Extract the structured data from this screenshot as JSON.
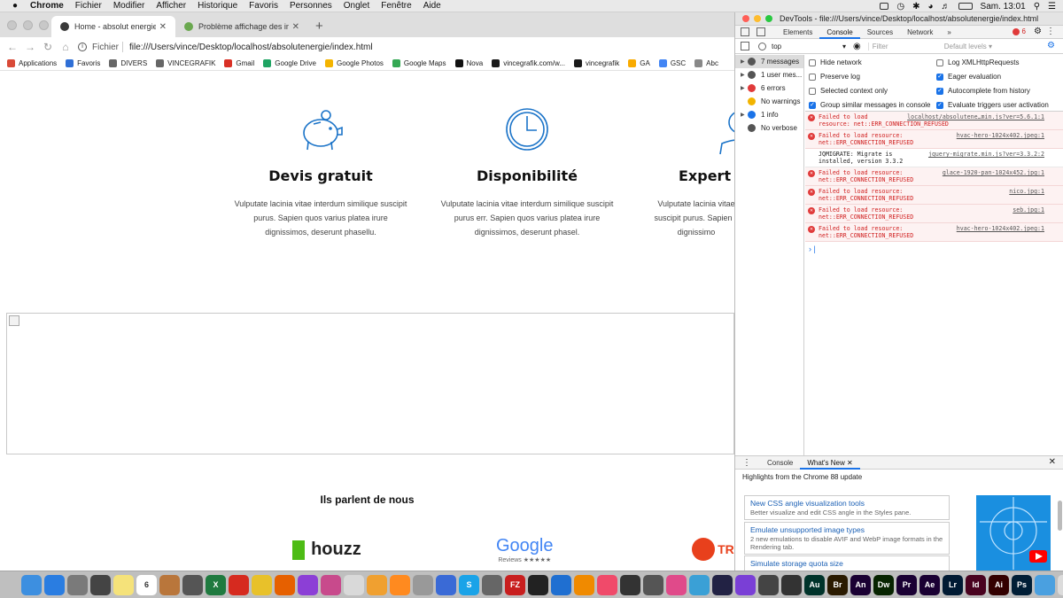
{
  "menubar": {
    "items": [
      "Chrome",
      "Fichier",
      "Modifier",
      "Afficher",
      "Historique",
      "Favoris",
      "Personnes",
      "Onglet",
      "Fenêtre",
      "Aide"
    ],
    "clock": "Sam. 13:01"
  },
  "browser": {
    "tabs": [
      {
        "title": "Home - absolut energie",
        "icon_color": "#3a3a3a"
      },
      {
        "title": "Problème affichage des image",
        "icon_color": "#6aa84f"
      }
    ],
    "url_scheme": "Fichier",
    "url": "file:///Users/vince/Desktop/localhost/absolutenergie/index.html",
    "bookmarks": [
      {
        "label": "Applications",
        "icon": "grid-icon",
        "color": "#d94a38"
      },
      {
        "label": "Favoris",
        "icon": "star-icon",
        "color": "#2f6fd6"
      },
      {
        "label": "DIVERS",
        "icon": "folder-icon",
        "color": "#666666"
      },
      {
        "label": "VINCEGRAFIK",
        "icon": "folder-icon",
        "color": "#666666"
      },
      {
        "label": "Gmail",
        "icon": "gmail-icon",
        "color": "#d93025"
      },
      {
        "label": "Google Drive",
        "icon": "drive-icon",
        "color": "#1fa463"
      },
      {
        "label": "Google Photos",
        "icon": "photos-icon",
        "color": "#f4b400"
      },
      {
        "label": "Google Maps",
        "icon": "maps-icon",
        "color": "#34a853"
      },
      {
        "label": "Nova",
        "icon": "nova-icon",
        "color": "#111111"
      },
      {
        "label": "vincegrafik.com/w...",
        "icon": "vg-icon",
        "color": "#1a1a1a"
      },
      {
        "label": "vincegrafik",
        "icon": "vg-icon",
        "color": "#1a1a1a"
      },
      {
        "label": "GA",
        "icon": "analytics-icon",
        "color": "#f9ab00"
      },
      {
        "label": "GSC",
        "icon": "gsc-icon",
        "color": "#4285f4"
      },
      {
        "label": "Abc",
        "icon": "page-icon",
        "color": "#888888"
      }
    ]
  },
  "page": {
    "features": [
      {
        "title": "Devis gratuit",
        "text": "Vulputate lacinia vitae interdum similique suscipit purus. Sapien quos varius platea irure dignissimos, deserunt phasellu.",
        "icon": "piggy-bank-icon"
      },
      {
        "title": "Disponibilité",
        "text": "Vulputate lacinia vitae interdum similique suscipit purus err. Sapien quos varius platea irure dignissimos, deserunt phasel.",
        "icon": "clock-icon"
      },
      {
        "title": "Expert c",
        "text": "Vulputate lacinia vitae suscipit purus. Sapien c dignissimo",
        "icon": "expert-icon"
      }
    ],
    "testimonials_title": "Ils parlent de nous",
    "logos": [
      {
        "name": "houzz",
        "color": "#4dbc15"
      },
      {
        "name": "Google",
        "sub": "Reviews ★★★★★"
      },
      {
        "name": "TR",
        "color": "#e8401c"
      }
    ]
  },
  "devtools": {
    "title": "DevTools - file:///Users/vince/Desktop/localhost/absolutenergie/index.html",
    "tabs": [
      "Elements",
      "Console",
      "Sources",
      "Network",
      "»"
    ],
    "active_tab": "Console",
    "error_badge": "6",
    "context": "top",
    "filter_placeholder": "Filter",
    "levels": "Default levels ▾",
    "sidebar": [
      {
        "label": "7 messages",
        "icon": "list-icon",
        "color": "#555555"
      },
      {
        "label": "1 user mes...",
        "icon": "user-icon",
        "color": "#555555"
      },
      {
        "label": "6 errors",
        "icon": "error-icon",
        "color": "#e03a3a"
      },
      {
        "label": "No warnings",
        "icon": "warning-icon",
        "color": "#f2b400"
      },
      {
        "label": "1 info",
        "icon": "info-icon",
        "color": "#1a73e8"
      },
      {
        "label": "No verbose",
        "icon": "verbose-icon",
        "color": "#555555"
      }
    ],
    "settings": [
      {
        "label": "Hide network",
        "checked": false
      },
      {
        "label": "Log XMLHttpRequests",
        "checked": false
      },
      {
        "label": "Preserve log",
        "checked": false
      },
      {
        "label": "Eager evaluation",
        "checked": true
      },
      {
        "label": "Selected context only",
        "checked": false
      },
      {
        "label": "Autocomplete from history",
        "checked": true
      },
      {
        "label": "Group similar messages in console",
        "checked": true
      },
      {
        "label": "Evaluate triggers user activation",
        "checked": true
      }
    ],
    "messages": [
      {
        "type": "error",
        "line1": "Failed to load",
        "line2": "resource: net::ERR_CONNECTION_REFUSED",
        "source": "localhost/absolutene…min.js?ver=5.6.1:1"
      },
      {
        "type": "error",
        "line1": "Failed to load resource:",
        "line2": "net::ERR_CONNECTION_REFUSED",
        "source": "hvac-hero-1024x402.jpeg:1"
      },
      {
        "type": "log",
        "line1": "JQMIGRATE: Migrate is",
        "line2": "installed, version 3.3.2",
        "source": "jquery-migrate.min.js?ver=3.3.2:2"
      },
      {
        "type": "error",
        "line1": "Failed to load resource:",
        "line2": "net::ERR_CONNECTION_REFUSED",
        "source": "glace-1920-pan-1024x452.jpg:1"
      },
      {
        "type": "error",
        "line1": "Failed to load resource:",
        "line2": "net::ERR_CONNECTION_REFUSED",
        "source": "nico.jpg:1"
      },
      {
        "type": "error",
        "line1": "Failed to load resource:",
        "line2": "net::ERR_CONNECTION_REFUSED",
        "source": "seb.jpg:1"
      },
      {
        "type": "error",
        "line1": "Failed to load resource:",
        "line2": "net::ERR_CONNECTION_REFUSED",
        "source": "hvac-hero-1024x402.jpeg:1"
      }
    ],
    "drawer": {
      "tabs": [
        "Console",
        "What's New"
      ],
      "active_tab": "What's New",
      "heading": "Highlights from the Chrome 88 update",
      "cards": [
        {
          "title": "New CSS angle visualization tools",
          "desc": "Better visualize and edit CSS angle in the Styles pane."
        },
        {
          "title": "Emulate unsupported image types",
          "desc": "2 new emulations to disable AVIF and WebP image formats in the Rendering tab."
        },
        {
          "title": "Simulate storage quota size",
          "desc": ""
        }
      ]
    }
  },
  "dock": [
    {
      "name": "finder",
      "color": "#3d8fe0",
      "label": ""
    },
    {
      "name": "app-store",
      "color": "#2a7de1",
      "label": ""
    },
    {
      "name": "system-preferences",
      "color": "#7a7a7a",
      "label": ""
    },
    {
      "name": "app",
      "color": "#444444",
      "label": ""
    },
    {
      "name": "notes",
      "color": "#f5e27a",
      "label": ""
    },
    {
      "name": "calendar",
      "color": "#ffffff",
      "label": "6"
    },
    {
      "name": "app",
      "color": "#b9763b",
      "label": ""
    },
    {
      "name": "app",
      "color": "#555555",
      "label": ""
    },
    {
      "name": "excel",
      "color": "#1f7a3f",
      "label": "X"
    },
    {
      "name": "acrobat",
      "color": "#d62a1f",
      "label": ""
    },
    {
      "name": "chrome",
      "color": "#e8c12a",
      "label": ""
    },
    {
      "name": "firefox",
      "color": "#e66000",
      "label": ""
    },
    {
      "name": "podcasts",
      "color": "#8c3fd6",
      "label": ""
    },
    {
      "name": "app",
      "color": "#c84a8c",
      "label": ""
    },
    {
      "name": "app",
      "color": "#d9d9d9",
      "label": ""
    },
    {
      "name": "app",
      "color": "#f0a030",
      "label": ""
    },
    {
      "name": "app",
      "color": "#ff8a1f",
      "label": ""
    },
    {
      "name": "app",
      "color": "#999999",
      "label": ""
    },
    {
      "name": "app",
      "color": "#3a6ad6",
      "label": ""
    },
    {
      "name": "skype",
      "color": "#1aa3e8",
      "label": "S"
    },
    {
      "name": "app",
      "color": "#666666",
      "label": ""
    },
    {
      "name": "filezilla",
      "color": "#c81e1e",
      "label": "FZ"
    },
    {
      "name": "app",
      "color": "#222222",
      "label": ""
    },
    {
      "name": "app",
      "color": "#1f6fd1",
      "label": ""
    },
    {
      "name": "vlc",
      "color": "#f08a00",
      "label": ""
    },
    {
      "name": "music",
      "color": "#f04a6a",
      "label": ""
    },
    {
      "name": "app",
      "color": "#333333",
      "label": ""
    },
    {
      "name": "app",
      "color": "#555555",
      "label": ""
    },
    {
      "name": "app",
      "color": "#e04a8a",
      "label": ""
    },
    {
      "name": "app",
      "color": "#3aa0d6",
      "label": ""
    },
    {
      "name": "app",
      "color": "#222244",
      "label": ""
    },
    {
      "name": "app",
      "color": "#7a3fd6",
      "label": ""
    },
    {
      "name": "app",
      "color": "#444444",
      "label": ""
    },
    {
      "name": "app",
      "color": "#333333",
      "label": ""
    },
    {
      "name": "audition",
      "color": "#00332a",
      "label": "Au"
    },
    {
      "name": "bridge",
      "color": "#2a1a00",
      "label": "Br"
    },
    {
      "name": "animate",
      "color": "#1a0033",
      "label": "An"
    },
    {
      "name": "dreamweaver",
      "color": "#072401",
      "label": "Dw"
    },
    {
      "name": "premiere",
      "color": "#1a0033",
      "label": "Pr"
    },
    {
      "name": "after-effects",
      "color": "#1a0033",
      "label": "Ae"
    },
    {
      "name": "lightroom",
      "color": "#001a33",
      "label": "Lr"
    },
    {
      "name": "indesign",
      "color": "#49021f",
      "label": "Id"
    },
    {
      "name": "illustrator",
      "color": "#330000",
      "label": "Ai"
    },
    {
      "name": "photoshop",
      "color": "#001e36",
      "label": "Ps"
    },
    {
      "name": "folder",
      "color": "#4aa0e0",
      "label": ""
    },
    {
      "name": "trash",
      "color": "#dcdcdc",
      "label": ""
    }
  ]
}
